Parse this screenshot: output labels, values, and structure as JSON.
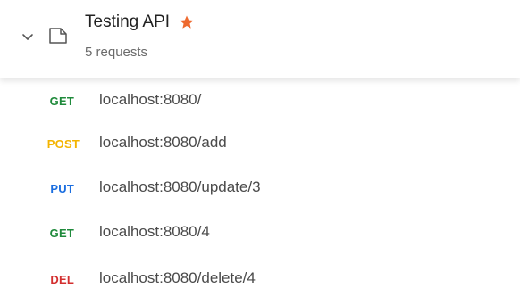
{
  "collection": {
    "title": "Testing API",
    "request_count": "5 requests",
    "star_color": "#ee6a2f",
    "icons": {
      "expand": "chevron-down-icon",
      "collection": "folder-icon",
      "favorite": "star-icon"
    }
  },
  "requests": [
    {
      "method": "GET",
      "method_color": "#1f8a3b",
      "url": "localhost:8080/"
    },
    {
      "method": "POST",
      "method_color": "#f4b400",
      "url": "localhost:8080/add"
    },
    {
      "method": "PUT",
      "method_color": "#1b6ee0",
      "url": "localhost:8080/update/3"
    },
    {
      "method": "GET",
      "method_color": "#1f8a3b",
      "url": "localhost:8080/4"
    },
    {
      "method": "DEL",
      "method_color": "#d32f2f",
      "url": "localhost:8080/delete/4"
    }
  ]
}
